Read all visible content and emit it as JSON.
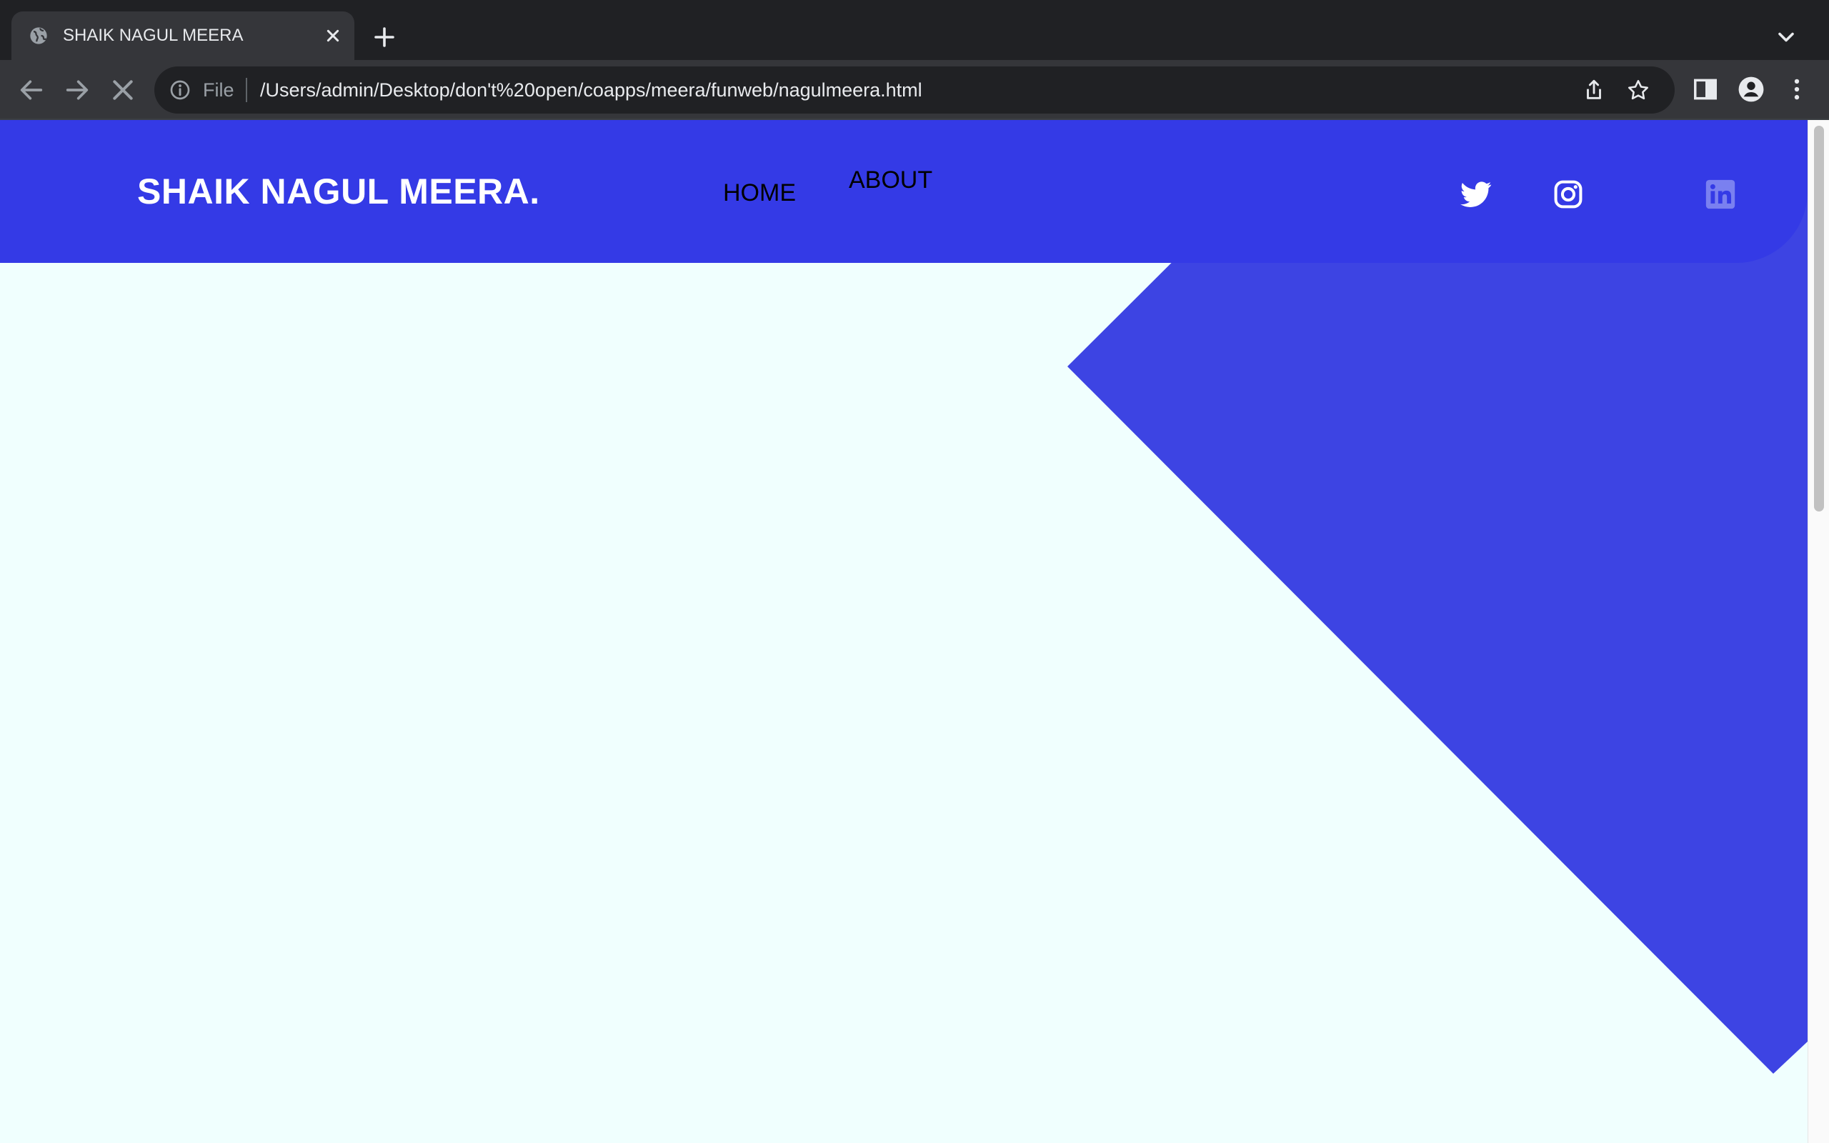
{
  "browser": {
    "tab": {
      "title": "SHAIK NAGUL MEERA",
      "favicon": "globe-icon",
      "close_icon": "close-icon"
    },
    "new_tab_icon": "plus-icon",
    "tab_search_icon": "chevron-down-icon",
    "nav": {
      "back_icon": "arrow-left-icon",
      "forward_icon": "arrow-right-icon",
      "stop_icon": "stop-loading-icon"
    },
    "omnibox": {
      "info_icon": "info-icon",
      "scheme": "File",
      "url": "/Users/admin/Desktop/don't%20open/coapps/meera/funweb/nagulmeera.html",
      "share_icon": "share-icon",
      "bookmark_icon": "star-icon"
    },
    "toolbar_icons": [
      "side-panel-icon",
      "profile-icon",
      "more-vertical-icon"
    ]
  },
  "page": {
    "brand": "SHAIK NAGUL MEERA.",
    "nav_links": [
      {
        "label": "HOME"
      },
      {
        "label": "ABOUT"
      }
    ],
    "social_icons": [
      "twitter-icon",
      "instagram-icon",
      "linkedin-icon"
    ],
    "colors": {
      "header_bg": "#343ae6",
      "shape": "#3d44e3",
      "page_bg": "#f0fffe",
      "linkedin": "#7a80f0"
    }
  }
}
